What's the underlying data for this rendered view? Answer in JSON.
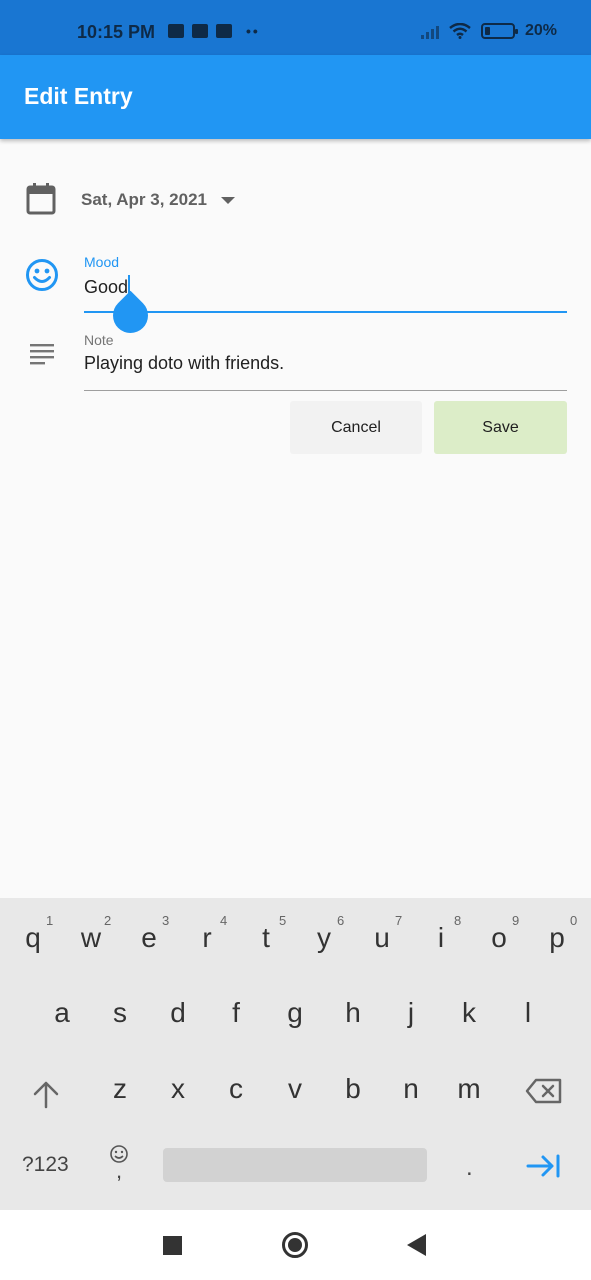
{
  "status_bar": {
    "time": "10:15 PM",
    "battery_text": "20%",
    "battery_level": 0.2,
    "icons": [
      "keyboard-icon",
      "news-icon",
      "trash-icon",
      "dots-icon",
      "signal-icon",
      "wifi-icon",
      "battery-icon"
    ]
  },
  "app_bar": {
    "title": "Edit Entry",
    "color": "#2196f3"
  },
  "form": {
    "date_value": "Sat, Apr 3, 2021",
    "mood": {
      "label": "Mood",
      "value": "Good"
    },
    "note": {
      "label": "Note",
      "value": "Playing doto with friends."
    },
    "cancel_label": "Cancel",
    "save_label": "Save",
    "accent_color": "#2196f3",
    "save_color": "#dcedc8"
  },
  "keyboard": {
    "row1": [
      "q",
      "w",
      "e",
      "r",
      "t",
      "y",
      "u",
      "i",
      "o",
      "p"
    ],
    "row1_hints": [
      "1",
      "2",
      "3",
      "4",
      "5",
      "6",
      "7",
      "8",
      "9",
      "0"
    ],
    "row2": [
      "a",
      "s",
      "d",
      "f",
      "g",
      "h",
      "j",
      "k",
      "l"
    ],
    "row3": [
      "z",
      "x",
      "c",
      "v",
      "b",
      "n",
      "m"
    ],
    "symbols_label": "?123",
    "comma_label": ",",
    "period_label": "."
  },
  "nav_bar": {
    "icons": [
      "recents-icon",
      "home-icon",
      "back-icon"
    ]
  }
}
